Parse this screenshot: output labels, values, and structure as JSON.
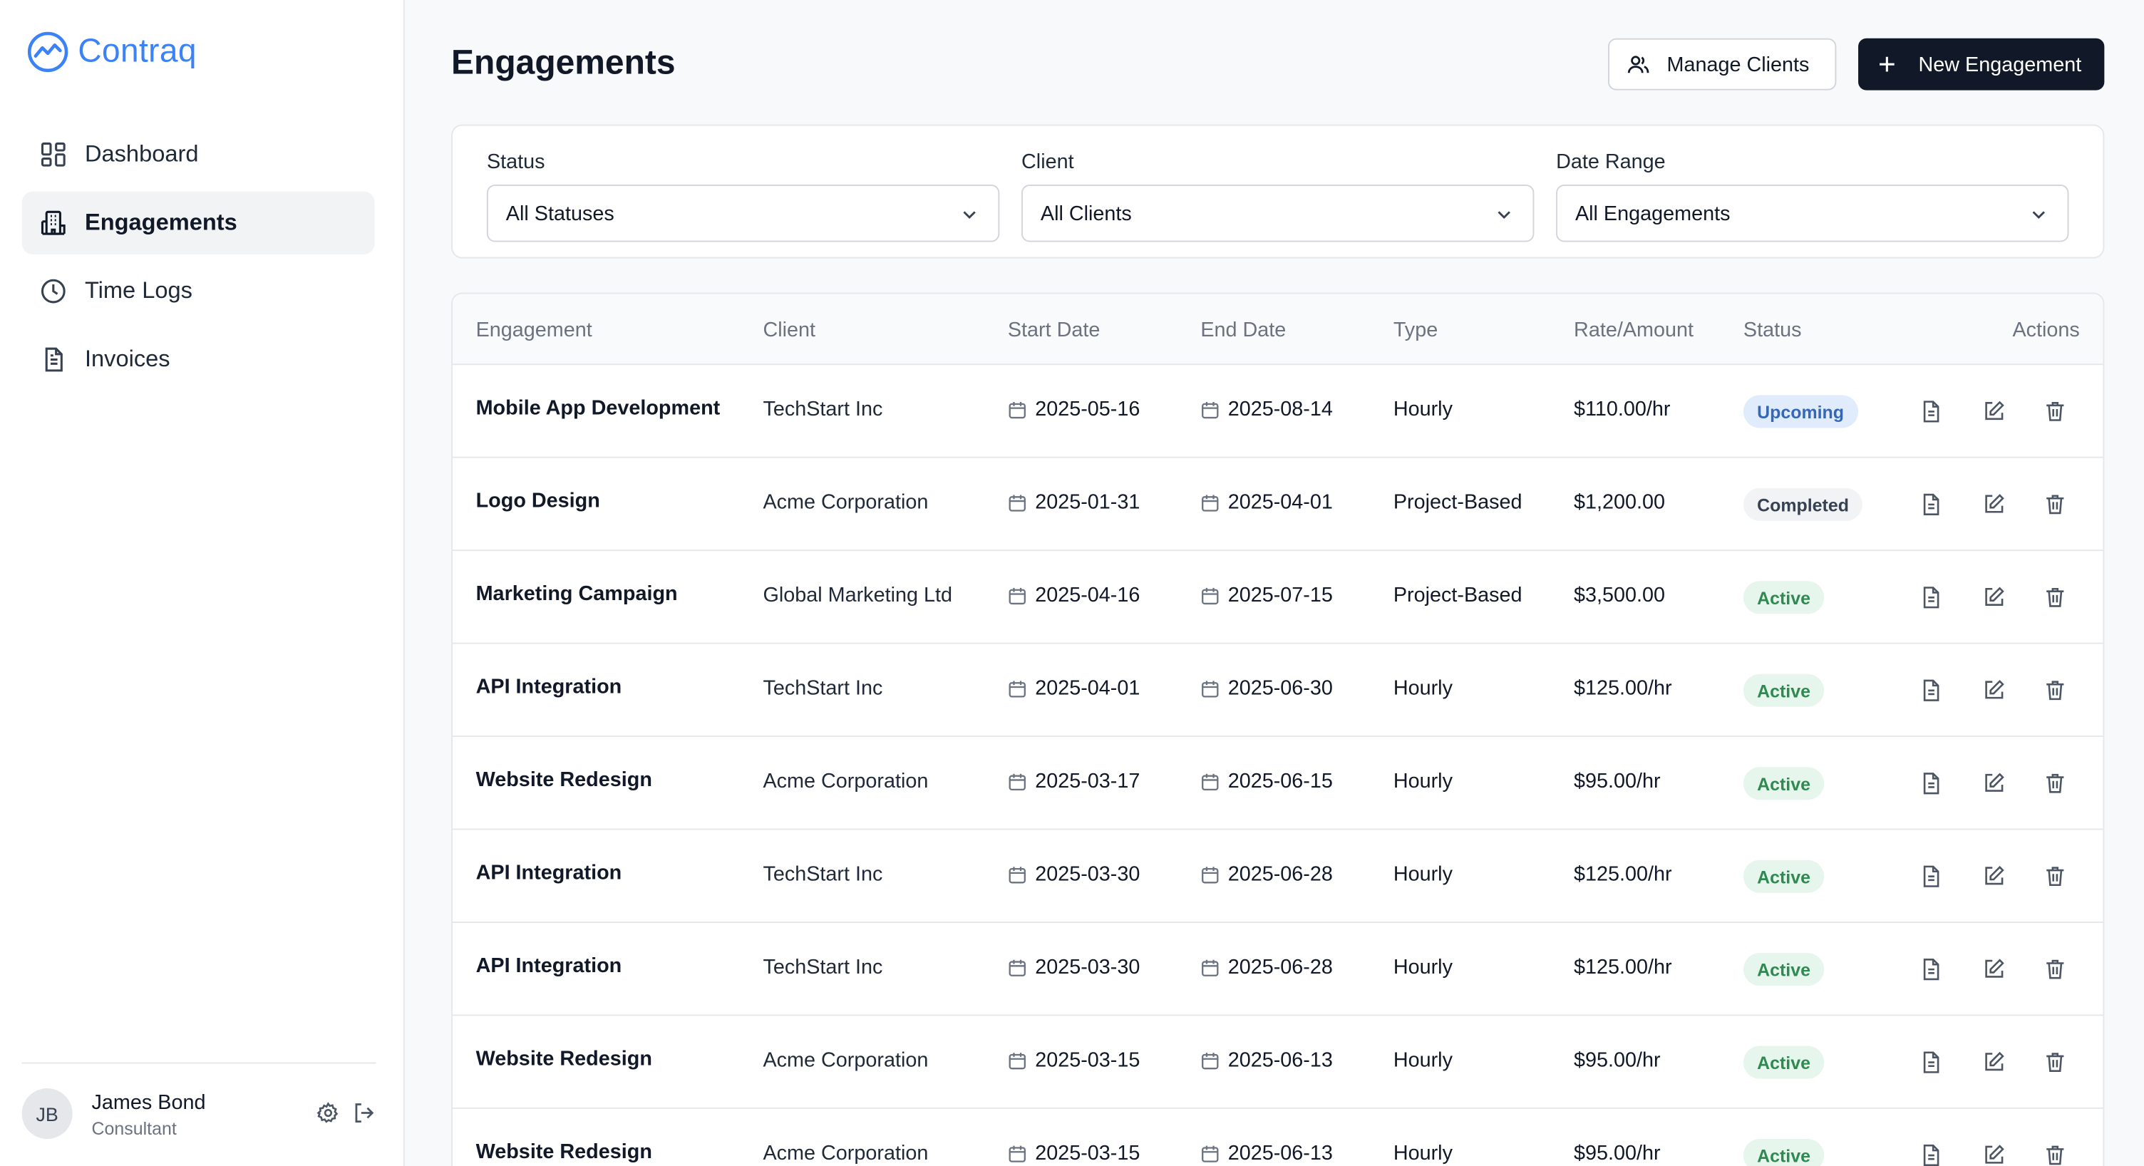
{
  "brand": {
    "name": "Contraq",
    "color": "#3b82f6"
  },
  "sidebar": {
    "items": [
      {
        "label": "Dashboard",
        "icon": "dashboard-icon",
        "active": false
      },
      {
        "label": "Engagements",
        "icon": "building-icon",
        "active": true
      },
      {
        "label": "Time Logs",
        "icon": "clock-icon",
        "active": false
      },
      {
        "label": "Invoices",
        "icon": "file-icon",
        "active": false
      }
    ],
    "user": {
      "initials": "JB",
      "name": "James Bond",
      "role": "Consultant"
    }
  },
  "header": {
    "title": "Engagements",
    "manage_clients_label": "Manage Clients",
    "new_engagement_label": "New Engagement"
  },
  "filters": {
    "status": {
      "label": "Status",
      "value": "All Statuses"
    },
    "client": {
      "label": "Client",
      "value": "All Clients"
    },
    "date_range": {
      "label": "Date Range",
      "value": "All Engagements"
    }
  },
  "table": {
    "columns": [
      "Engagement",
      "Client",
      "Start Date",
      "End Date",
      "Type",
      "Rate/Amount",
      "Status",
      "Actions"
    ],
    "rows": [
      {
        "engagement": "Mobile App Development",
        "client": "TechStart Inc",
        "start": "2025-05-16",
        "end": "2025-08-14",
        "type": "Hourly",
        "rate": "$110.00/hr",
        "status": "Upcoming"
      },
      {
        "engagement": "Logo Design",
        "client": "Acme Corporation",
        "start": "2025-01-31",
        "end": "2025-04-01",
        "type": "Project-Based",
        "rate": "$1,200.00",
        "status": "Completed"
      },
      {
        "engagement": "Marketing Campaign",
        "client": "Global Marketing Ltd",
        "start": "2025-04-16",
        "end": "2025-07-15",
        "type": "Project-Based",
        "rate": "$3,500.00",
        "status": "Active"
      },
      {
        "engagement": "API Integration",
        "client": "TechStart Inc",
        "start": "2025-04-01",
        "end": "2025-06-30",
        "type": "Hourly",
        "rate": "$125.00/hr",
        "status": "Active"
      },
      {
        "engagement": "Website Redesign",
        "client": "Acme Corporation",
        "start": "2025-03-17",
        "end": "2025-06-15",
        "type": "Hourly",
        "rate": "$95.00/hr",
        "status": "Active"
      },
      {
        "engagement": "API Integration",
        "client": "TechStart Inc",
        "start": "2025-03-30",
        "end": "2025-06-28",
        "type": "Hourly",
        "rate": "$125.00/hr",
        "status": "Active"
      },
      {
        "engagement": "API Integration",
        "client": "TechStart Inc",
        "start": "2025-03-30",
        "end": "2025-06-28",
        "type": "Hourly",
        "rate": "$125.00/hr",
        "status": "Active"
      },
      {
        "engagement": "Website Redesign",
        "client": "Acme Corporation",
        "start": "2025-03-15",
        "end": "2025-06-13",
        "type": "Hourly",
        "rate": "$95.00/hr",
        "status": "Active"
      },
      {
        "engagement": "Website Redesign",
        "client": "Acme Corporation",
        "start": "2025-03-15",
        "end": "2025-06-13",
        "type": "Hourly",
        "rate": "$95.00/hr",
        "status": "Active"
      }
    ]
  }
}
